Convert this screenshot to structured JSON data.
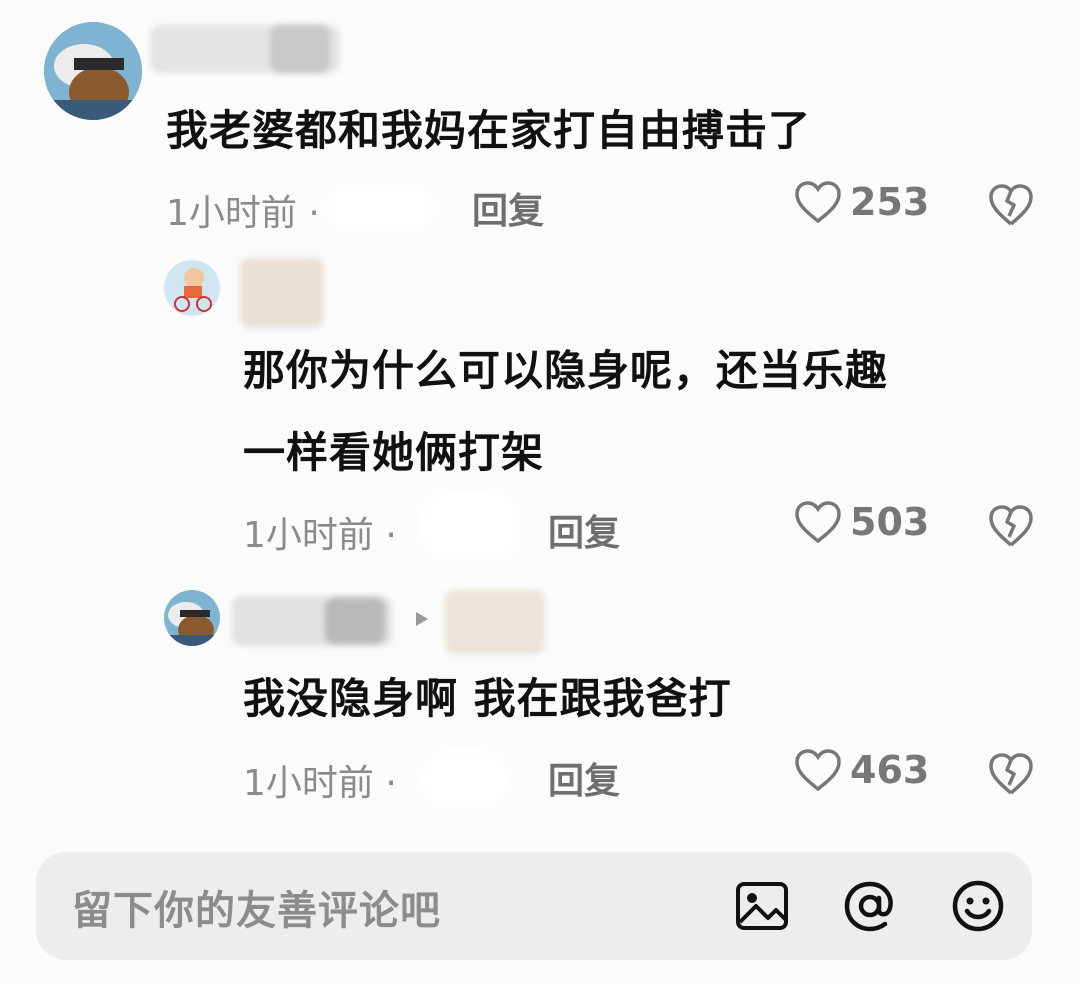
{
  "comments": [
    {
      "text": "我老婆都和我妈在家打自由搏击了",
      "time": "1小时前 ·",
      "reply_label": "回复",
      "likes": "253"
    },
    {
      "text_line1": "那你为什么可以隐身呢，还当乐趣",
      "text_line2": "一样看她俩打架",
      "time": "1小时前 ·",
      "reply_label": "回复",
      "likes": "503"
    },
    {
      "text": "我没隐身啊 我在跟我爸打",
      "time": "1小时前 ·",
      "reply_label": "回复",
      "likes": "463"
    }
  ],
  "input": {
    "placeholder": "留下你的友善评论吧"
  },
  "icons": [
    "heart-icon",
    "broken-heart-icon",
    "image-icon",
    "at-icon",
    "emoji-icon"
  ],
  "colors": {
    "background": "#fbfbfb",
    "muted": "#8a8a8a",
    "input_bg": "#ededed"
  }
}
